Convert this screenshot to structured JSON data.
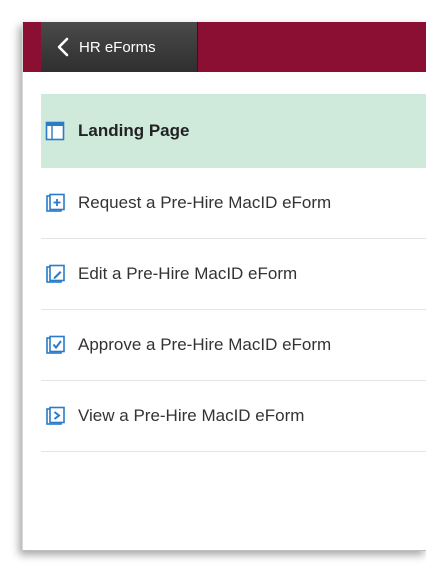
{
  "header": {
    "back_label": "HR eForms",
    "brand_color": "#8a0f33"
  },
  "nav": {
    "items": [
      {
        "label": "Landing Page",
        "icon": "landing-page-icon",
        "active": true
      },
      {
        "label": "Request a Pre-Hire MacID eForm",
        "icon": "request-form-icon",
        "active": false
      },
      {
        "label": "Edit a Pre-Hire MacID eForm",
        "icon": "edit-form-icon",
        "active": false
      },
      {
        "label": "Approve a Pre-Hire MacID eForm",
        "icon": "approve-form-icon",
        "active": false
      },
      {
        "label": "View a Pre-Hire MacID eForm",
        "icon": "view-form-icon",
        "active": false
      }
    ],
    "active_color": "#cfeadb",
    "icon_color": "#2a7bc8"
  }
}
